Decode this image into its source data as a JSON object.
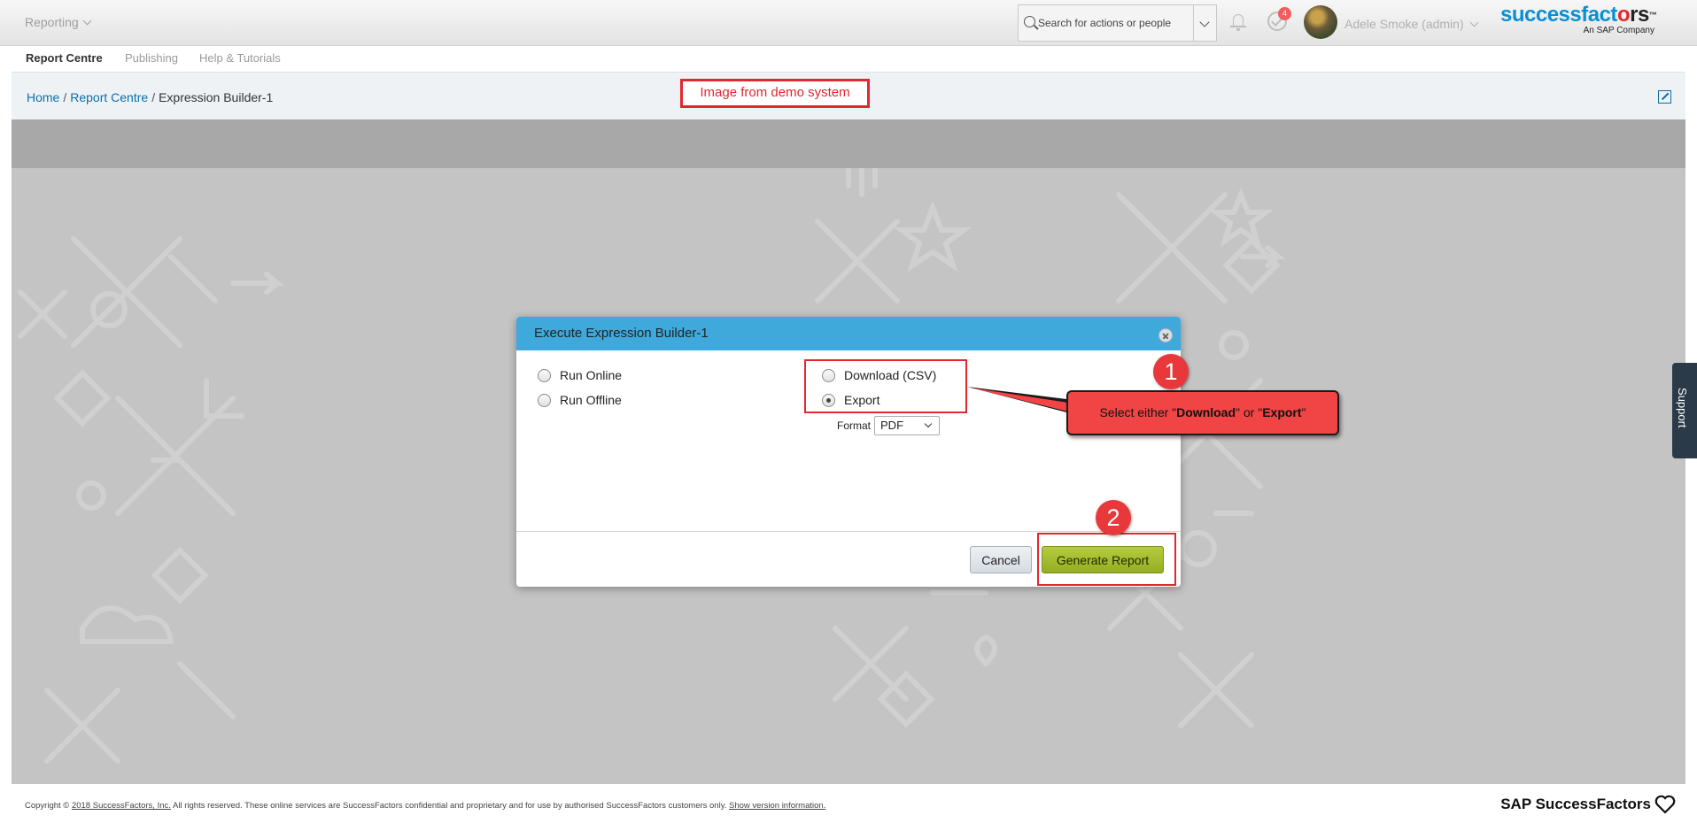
{
  "shell": {
    "module_label": "Reporting",
    "search_placeholder": "Search for actions or people",
    "todo_count": "4",
    "user_name": "Adele Smoke (admin)",
    "logo_text_blue": "successfact",
    "logo_text_dark": "rs",
    "logo_o": "o",
    "logo_tm": "™",
    "logo_sub": "An SAP Company"
  },
  "tabs": [
    "Report Centre",
    "Publishing",
    "Help & Tutorials"
  ],
  "breadcrumb": {
    "home": "Home",
    "report_centre": "Report Centre",
    "current": "Expression Builder-1",
    "separator": "/"
  },
  "demo_label": "Image from demo system",
  "support_label": "Support",
  "dialog": {
    "title": "Execute Expression Builder-1",
    "options": {
      "run_online": "Run Online",
      "run_offline": "Run Offline",
      "download_csv": "Download (CSV)",
      "export": "Export"
    },
    "selected_option": "Export",
    "format_label": "Format",
    "format_value": "PDF",
    "cancel_label": "Cancel",
    "generate_label": "Generate Report"
  },
  "annotations": {
    "step1": "1",
    "step2": "2",
    "callout_prefix": "Select either \"",
    "callout_download": "Download",
    "callout_middle": "\" or \"",
    "callout_export": "Export",
    "callout_suffix": "\""
  },
  "footer": {
    "copyright_prefix": "Copyright ©",
    "copyright_link": "2018 SuccessFactors, Inc.",
    "copyright_text": "All rights reserved. These online services are SuccessFactors confidential and proprietary and for use by authorised SuccessFactors customers only.",
    "version_link": "Show version information.",
    "brand": "SAP SuccessFactors"
  },
  "colors": {
    "dialog_header": "#3fa9dc",
    "generate_button": "#a4bd2e",
    "annotation_red": "#e3262f",
    "link_blue": "#0b6ea8",
    "logo_blue": "#0a8fd4"
  }
}
